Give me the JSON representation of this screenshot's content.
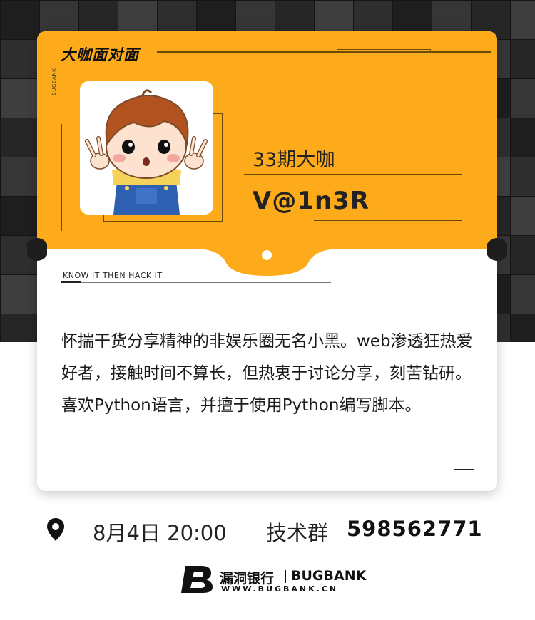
{
  "brand": "大咖面对面",
  "side_label": "BUGBANK",
  "guest": {
    "issue": "33期大咖",
    "name": "V@1n3R"
  },
  "motto": "KNOW  IT THEN  HACK  IT",
  "bio": "怀揣干货分享精神的非娱乐圈无名小黑。web渗透狂热爱好者，接触时间不算长，但热衷于讨论分享，刻苦钻研。喜欢Python语言，并擅于使用Python编写脚本。",
  "event": {
    "date": "8月4日 20:00",
    "group_label": "技术群",
    "group_number": "598562771"
  },
  "footer": {
    "logo_cn": "漏洞银行",
    "logo_en": "BUGBANK",
    "url": "WWW.BUGBANK.CN"
  },
  "colors": {
    "accent": "#fdab1a",
    "text": "#222222",
    "background_dark": "#1d1d1d"
  },
  "icons": [
    "location-pin-icon",
    "bugbank-logo-icon"
  ]
}
